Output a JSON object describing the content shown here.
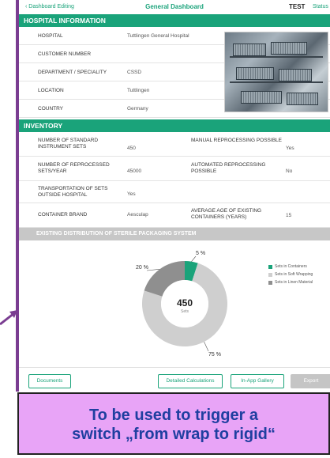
{
  "topbar": {
    "back_label": "‹ Dashboard Editing",
    "title": "General Dashboard",
    "test_label": "TEST",
    "status_label": "Status"
  },
  "hospital_info": {
    "heading": "HOSPITAL INFORMATION",
    "rows": [
      {
        "label": "HOSPITAL",
        "value": "Tuttlingen General Hospital"
      },
      {
        "label": "CUSTOMER NUMBER",
        "value": ""
      },
      {
        "label": "DEPARTMENT / SPECIALITY",
        "value": "CSSD"
      },
      {
        "label": "LOCATION",
        "value": "Tuttlingen"
      },
      {
        "label": "COUNTRY",
        "value": "Germany"
      }
    ]
  },
  "inventory": {
    "heading": "INVENTORY",
    "rows": [
      {
        "label1": "NUMBER OF STANDARD INSTRUMENT SETS",
        "value1": "450",
        "label2": "MANUAL REPROCESSING POSSIBLE",
        "value2": "Yes"
      },
      {
        "label1": "NUMBER OF REPROCESSED SETS/YEAR",
        "value1": "45000",
        "label2": "AUTOMATED REPROCESSING POSSIBLE",
        "value2": "No"
      },
      {
        "label1": "TRANSPORTATION OF SETS OUTSIDE HOSPITAL",
        "value1": "Yes",
        "label2": "",
        "value2": ""
      },
      {
        "label1": "CONTAINER BRAND",
        "value1": "Aesculap",
        "label2": "AVERAGE AGE OF EXISTING CONTAINERS (YEARS)",
        "value2": "15"
      }
    ]
  },
  "distribution": {
    "heading": "EXISTING DISTRIBUTION OF STERILE PACKAGING SYSTEM"
  },
  "chart_data": {
    "type": "pie",
    "categories": [
      "Sets in Containers",
      "Sets in Soft Wrapping",
      "Sets in Linen Material"
    ],
    "values": [
      5,
      75,
      20
    ],
    "value_labels": [
      "5 %",
      "75 %",
      "20 %"
    ],
    "center_value": "450",
    "center_label": "Sets",
    "colors": [
      "#1aa37a",
      "#cfcfcf",
      "#8f8f8f"
    ],
    "legend_position": "right"
  },
  "buttons": {
    "documents": "Documents",
    "detailed": "Detailed Calculations",
    "gallery": "In-App Gallery",
    "export": "Export"
  },
  "callout": {
    "line1": "To be used to trigger a",
    "line2": "switch „from wrap to rigid“"
  },
  "colors": {
    "accent": "#1aa37a",
    "frame": "#7a3d91",
    "callout_bg": "#e8a4f7",
    "callout_text": "#1f3fa0"
  }
}
